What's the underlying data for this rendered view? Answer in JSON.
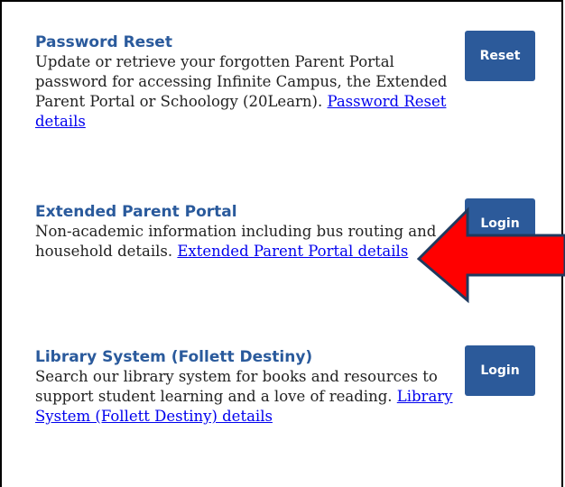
{
  "cards": [
    {
      "title": "Password Reset",
      "description": "Update or retrieve your forgotten Parent Portal password for accessing Infinite Campus, the Extended Parent Portal or Schoology (20Learn). ",
      "link": "Password Reset details",
      "button": "Reset"
    },
    {
      "title": "Extended Parent Portal",
      "description": "Non-academic information including bus routing and household details. ",
      "link": "Extended Parent Portal details",
      "button": "Login"
    },
    {
      "title": "Library System (Follett Destiny)",
      "description": "Search our library system for books and resources to support student learning and a love of reading. ",
      "link": "Library System (Follett Destiny) details",
      "button": "Login"
    }
  ],
  "annotation": {
    "arrow_color": "#ff0000",
    "arrow_outline": "#1f3a5f"
  }
}
